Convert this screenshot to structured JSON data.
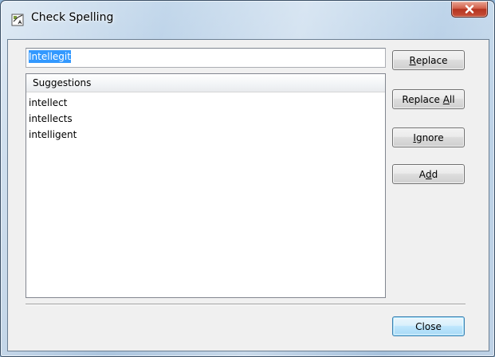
{
  "window": {
    "title": "Check Spelling"
  },
  "word": {
    "value": "Intellegit"
  },
  "suggestions": {
    "header": "Suggestions",
    "items": [
      "intellect",
      "intellects",
      "intelligent"
    ]
  },
  "buttons": {
    "replace": {
      "pre": "",
      "key": "R",
      "post": "eplace"
    },
    "replace_all": {
      "pre": "Replace ",
      "key": "A",
      "post": "ll"
    },
    "ignore": {
      "pre": "",
      "key": "I",
      "post": "gnore"
    },
    "add": {
      "pre": "A",
      "key": "d",
      "post": "d"
    },
    "close": "Close"
  },
  "icons": {
    "app": "spell-check-icon",
    "close": "close-icon"
  },
  "colors": {
    "selection": "#3399ff",
    "close_button": "#c7513a",
    "default_button_border": "#3c7fb1"
  }
}
